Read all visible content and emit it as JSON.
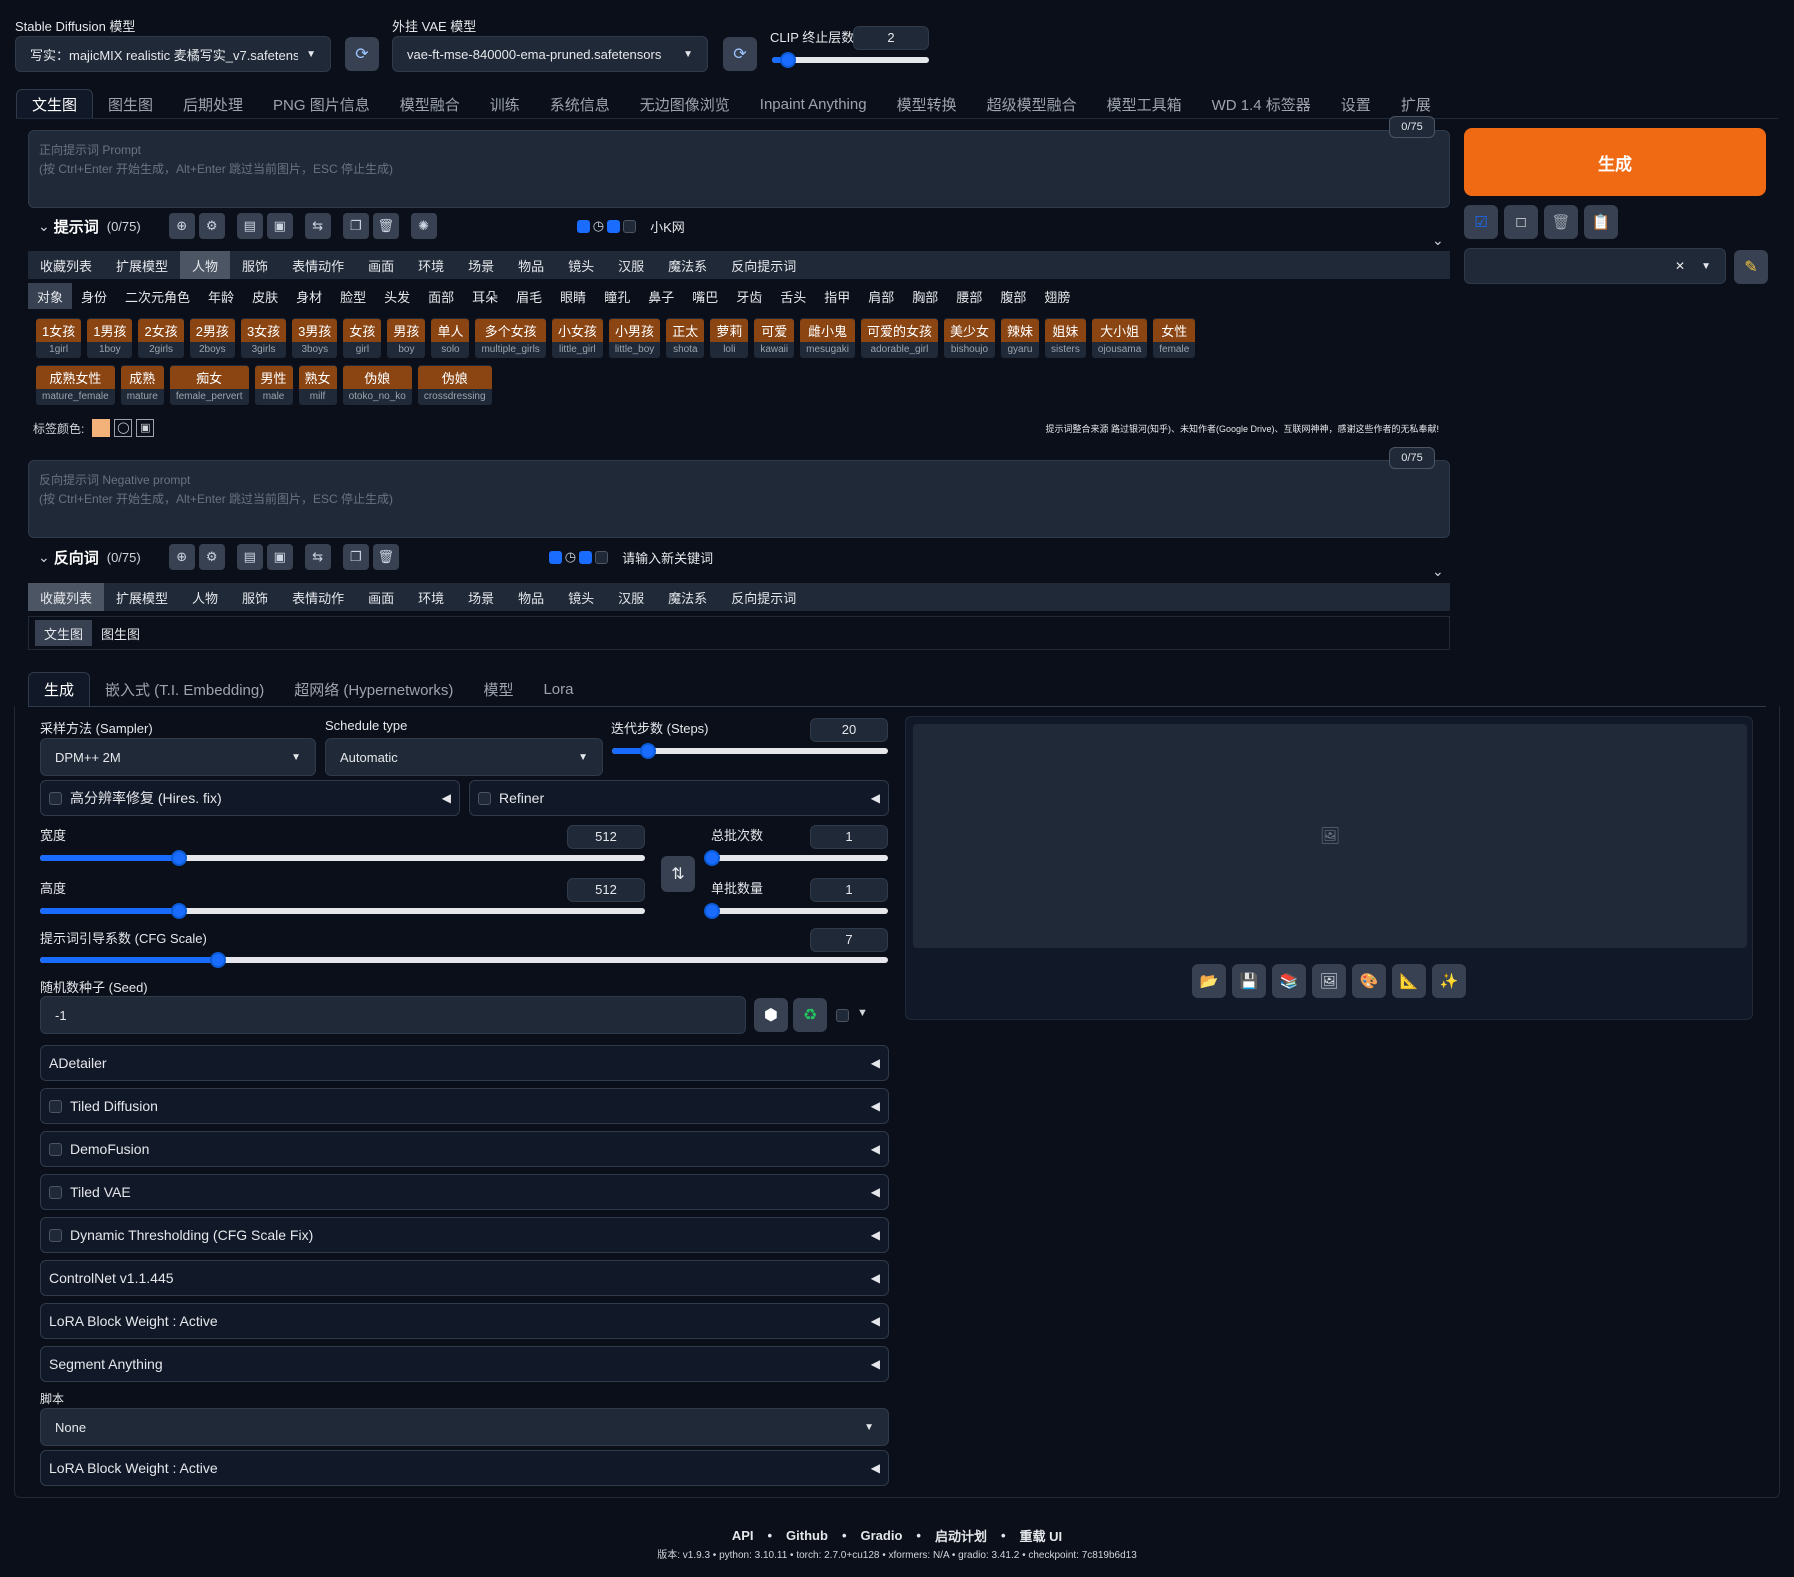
{
  "top": {
    "sd_model_label": "Stable Diffusion 模型",
    "sd_model_value": "写实：majicMIX realistic 麦橘写实_v7.safetens",
    "vae_label": "外挂 VAE 模型",
    "vae_value": "vae-ft-mse-840000-ema-pruned.safetensors",
    "clip_label": "CLIP 终止层数",
    "clip_value": "2",
    "clip_fraction": 0.1
  },
  "main_tabs": [
    "文生图",
    "图生图",
    "后期处理",
    "PNG 图片信息",
    "模型融合",
    "训练",
    "系统信息",
    "无边图像浏览",
    "Inpaint Anything",
    "模型转换",
    "超级模型融合",
    "模型工具箱",
    "WD 1.4 标签器",
    "设置",
    "扩展"
  ],
  "prompt": {
    "placeholder": "正向提示词 Prompt\n(按 Ctrl+Enter 开始生成，Alt+Enter 跳过当前图片，ESC 停止生成)",
    "counter": "0/75",
    "title": "提示词",
    "count": "(0/75)",
    "keyword_label": "小K网"
  },
  "negative": {
    "placeholder": "反向提示词 Negative prompt\n(按 Ctrl+Enter 开始生成，Alt+Enter 跳过当前图片，ESC 停止生成)",
    "counter": "0/75",
    "title": "反向词",
    "count": "(0/75)",
    "keyword_label": "请输入新关键词"
  },
  "categories": [
    "收藏列表",
    "扩展模型",
    "人物",
    "服饰",
    "表情动作",
    "画面",
    "环境",
    "场景",
    "物品",
    "镜头",
    "汉服",
    "魔法系",
    "反向提示词"
  ],
  "subcategories": [
    "对象",
    "身份",
    "二次元角色",
    "年龄",
    "皮肤",
    "身材",
    "脸型",
    "头发",
    "面部",
    "耳朵",
    "眉毛",
    "眼睛",
    "瞳孔",
    "鼻子",
    "嘴巴",
    "牙齿",
    "舌头",
    "指甲",
    "肩部",
    "胸部",
    "腰部",
    "腹部",
    "翅膀"
  ],
  "chips_row1": [
    {
      "t": "1女孩",
      "e": "1girl"
    },
    {
      "t": "1男孩",
      "e": "1boy"
    },
    {
      "t": "2女孩",
      "e": "2girls"
    },
    {
      "t": "2男孩",
      "e": "2boys"
    },
    {
      "t": "3女孩",
      "e": "3girls"
    },
    {
      "t": "3男孩",
      "e": "3boys"
    },
    {
      "t": "女孩",
      "e": "girl"
    },
    {
      "t": "男孩",
      "e": "boy"
    },
    {
      "t": "单人",
      "e": "solo"
    },
    {
      "t": "多个女孩",
      "e": "multiple_girls"
    },
    {
      "t": "小女孩",
      "e": "little_girl"
    },
    {
      "t": "小男孩",
      "e": "little_boy"
    },
    {
      "t": "正太",
      "e": "shota"
    },
    {
      "t": "萝莉",
      "e": "loli"
    },
    {
      "t": "可爱",
      "e": "kawaii"
    },
    {
      "t": "雌小鬼",
      "e": "mesugaki"
    },
    {
      "t": "可爱的女孩",
      "e": "adorable_girl"
    },
    {
      "t": "美少女",
      "e": "bishoujo"
    },
    {
      "t": "辣妹",
      "e": "gyaru"
    },
    {
      "t": "姐妹",
      "e": "sisters"
    },
    {
      "t": "大小姐",
      "e": "ojousama"
    },
    {
      "t": "女性",
      "e": "female"
    }
  ],
  "chips_row2": [
    {
      "t": "成熟女性",
      "e": "mature_female"
    },
    {
      "t": "成熟",
      "e": "mature"
    },
    {
      "t": "痴女",
      "e": "female_pervert"
    },
    {
      "t": "男性",
      "e": "male"
    },
    {
      "t": "熟女",
      "e": "milf"
    },
    {
      "t": "伪娘",
      "e": "otoko_no_ko"
    },
    {
      "t": "伪娘",
      "e": "crossdressing"
    }
  ],
  "tag_color_label": "标签颜色:",
  "source_note": "提示词整合来源 路过银河(知乎)、未知作者(Google Drive)、互联网神神，感谢这些作者的无私奉献!",
  "neg_subtabs": [
    "文生图",
    "图生图"
  ],
  "generate_label": "生成",
  "gen_tabs": [
    "生成",
    "嵌入式 (T.I. Embedding)",
    "超网络 (Hypernetworks)",
    "模型",
    "Lora"
  ],
  "sampler": {
    "label": "采样方法 (Sampler)",
    "value": "DPM++ 2M"
  },
  "schedule": {
    "label": "Schedule type",
    "value": "Automatic"
  },
  "steps": {
    "label": "迭代步数 (Steps)",
    "value": "20",
    "fraction": 0.13
  },
  "hires_label": "高分辨率修复 (Hires. fix)",
  "refiner_label": "Refiner",
  "width": {
    "label": "宽度",
    "value": "512",
    "fraction": 0.23
  },
  "height": {
    "label": "高度",
    "value": "512",
    "fraction": 0.23
  },
  "batch_count": {
    "label": "总批次数",
    "value": "1",
    "fraction": 0.0
  },
  "batch_size": {
    "label": "单批数量",
    "value": "1",
    "fraction": 0.0
  },
  "cfg": {
    "label": "提示词引导系数 (CFG Scale)",
    "value": "7",
    "fraction": 0.21
  },
  "seed": {
    "label": "随机数种子 (Seed)",
    "value": "-1"
  },
  "accordions": [
    {
      "label": "ADetailer",
      "check": false
    },
    {
      "label": "Tiled Diffusion",
      "check": true
    },
    {
      "label": "DemoFusion",
      "check": true
    },
    {
      "label": "Tiled VAE",
      "check": true
    },
    {
      "label": "Dynamic Thresholding (CFG Scale Fix)",
      "check": true
    },
    {
      "label": "ControlNet v1.1.445",
      "check": false
    },
    {
      "label": "LoRA Block Weight : Active",
      "check": false
    },
    {
      "label": "Segment Anything",
      "check": false
    }
  ],
  "script": {
    "label": "脚本",
    "value": "None"
  },
  "last_accordion": "LoRA Block Weight : Active",
  "footer": {
    "links": [
      "API",
      "Github",
      "Gradio",
      "启动计划",
      "重载 UI"
    ],
    "version": "版本: v1.9.3  •  python: 3.10.11  •  torch: 2.7.0+cu128  •  xformers: N/A  •  gradio: 3.41.2  •  checkpoint: 7c819b6d13"
  },
  "colors": {
    "accent": "#1a6cff",
    "generate": "#f06a14",
    "chip": "#8b4513"
  }
}
